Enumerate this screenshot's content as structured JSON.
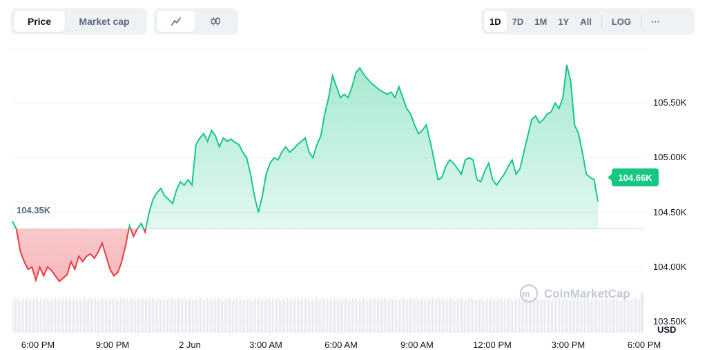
{
  "toolbar": {
    "metric_tabs": [
      {
        "label": "Price",
        "active": true
      },
      {
        "label": "Market cap",
        "active": false
      }
    ],
    "chart_type_icons": [
      "line-chart-icon",
      "candlestick-icon"
    ],
    "ranges": [
      {
        "label": "1D",
        "active": true
      },
      {
        "label": "7D",
        "active": false
      },
      {
        "label": "1M",
        "active": false
      },
      {
        "label": "1Y",
        "active": false
      },
      {
        "label": "All",
        "active": false
      }
    ],
    "log_label": "LOG",
    "more_label": "···"
  },
  "watermark": {
    "text": "CoinMarketCap"
  },
  "open_price_label": "104.35K",
  "current_price_label": "104.66K",
  "currency_label": "USD",
  "colors": {
    "up": "#16c784",
    "down": "#ea3943",
    "current_badge": "#16c784"
  },
  "chart_data": {
    "type": "area",
    "baseline": 104.35,
    "y_unit": "K USD",
    "ylim": [
      103.4,
      106.0
    ],
    "ytick_labels": [
      "105.50K",
      "105.00K",
      "104.50K",
      "104.00K",
      "103.50K"
    ],
    "ytick_values": [
      105.5,
      105.0,
      104.5,
      104.0,
      103.5
    ],
    "xtick_labels": [
      "6:00 PM",
      "9:00 PM",
      "2 Jun",
      "3:00 AM",
      "6:00 AM",
      "9:00 AM",
      "12:00 PM",
      "3:00 PM",
      "6:00 PM"
    ],
    "x_start_label": "6:00 PM",
    "x_end_label": "6:00 PM",
    "hours_span": 24.3,
    "points": [
      [
        0.0,
        104.42
      ],
      [
        0.15,
        104.35
      ],
      [
        0.3,
        104.15
      ],
      [
        0.45,
        104.05
      ],
      [
        0.6,
        103.98
      ],
      [
        0.75,
        104.0
      ],
      [
        0.9,
        103.88
      ],
      [
        1.05,
        104.0
      ],
      [
        1.2,
        103.92
      ],
      [
        1.35,
        104.0
      ],
      [
        1.5,
        103.97
      ],
      [
        1.65,
        103.92
      ],
      [
        1.8,
        103.87
      ],
      [
        1.95,
        103.9
      ],
      [
        2.1,
        103.93
      ],
      [
        2.25,
        104.05
      ],
      [
        2.4,
        103.98
      ],
      [
        2.55,
        104.1
      ],
      [
        2.7,
        104.05
      ],
      [
        2.85,
        104.1
      ],
      [
        3.0,
        104.12
      ],
      [
        3.15,
        104.08
      ],
      [
        3.3,
        104.14
      ],
      [
        3.45,
        104.22
      ],
      [
        3.6,
        104.1
      ],
      [
        3.75,
        103.98
      ],
      [
        3.9,
        103.92
      ],
      [
        4.05,
        103.95
      ],
      [
        4.2,
        104.05
      ],
      [
        4.35,
        104.2
      ],
      [
        4.5,
        104.38
      ],
      [
        4.65,
        104.28
      ],
      [
        4.8,
        104.35
      ],
      [
        4.95,
        104.4
      ],
      [
        5.1,
        104.32
      ],
      [
        5.25,
        104.5
      ],
      [
        5.4,
        104.62
      ],
      [
        5.55,
        104.68
      ],
      [
        5.7,
        104.72
      ],
      [
        5.85,
        104.65
      ],
      [
        6.0,
        104.62
      ],
      [
        6.15,
        104.58
      ],
      [
        6.3,
        104.7
      ],
      [
        6.45,
        104.78
      ],
      [
        6.6,
        104.75
      ],
      [
        6.75,
        104.8
      ],
      [
        6.9,
        104.75
      ],
      [
        7.05,
        105.12
      ],
      [
        7.2,
        105.18
      ],
      [
        7.35,
        105.22
      ],
      [
        7.5,
        105.15
      ],
      [
        7.65,
        105.25
      ],
      [
        7.8,
        105.2
      ],
      [
        7.95,
        105.1
      ],
      [
        8.1,
        105.18
      ],
      [
        8.25,
        105.15
      ],
      [
        8.4,
        105.17
      ],
      [
        8.55,
        105.14
      ],
      [
        8.7,
        105.12
      ],
      [
        8.85,
        105.05
      ],
      [
        9.0,
        105.0
      ],
      [
        9.15,
        104.85
      ],
      [
        9.3,
        104.65
      ],
      [
        9.45,
        104.5
      ],
      [
        9.6,
        104.65
      ],
      [
        9.75,
        104.85
      ],
      [
        9.9,
        104.95
      ],
      [
        10.05,
        105.0
      ],
      [
        10.2,
        104.98
      ],
      [
        10.35,
        105.05
      ],
      [
        10.5,
        105.1
      ],
      [
        10.65,
        105.05
      ],
      [
        10.8,
        105.08
      ],
      [
        10.95,
        105.12
      ],
      [
        11.1,
        105.15
      ],
      [
        11.25,
        105.18
      ],
      [
        11.4,
        105.05
      ],
      [
        11.55,
        105.0
      ],
      [
        11.7,
        105.12
      ],
      [
        11.85,
        105.2
      ],
      [
        12.0,
        105.4
      ],
      [
        12.15,
        105.55
      ],
      [
        12.3,
        105.75
      ],
      [
        12.45,
        105.65
      ],
      [
        12.6,
        105.55
      ],
      [
        12.75,
        105.58
      ],
      [
        12.9,
        105.55
      ],
      [
        13.05,
        105.65
      ],
      [
        13.2,
        105.78
      ],
      [
        13.35,
        105.82
      ],
      [
        13.5,
        105.76
      ],
      [
        13.65,
        105.72
      ],
      [
        13.8,
        105.68
      ],
      [
        13.95,
        105.65
      ],
      [
        14.1,
        105.62
      ],
      [
        14.25,
        105.6
      ],
      [
        14.4,
        105.58
      ],
      [
        14.55,
        105.6
      ],
      [
        14.7,
        105.55
      ],
      [
        14.85,
        105.65
      ],
      [
        15.0,
        105.55
      ],
      [
        15.15,
        105.45
      ],
      [
        15.3,
        105.4
      ],
      [
        15.45,
        105.3
      ],
      [
        15.6,
        105.22
      ],
      [
        15.75,
        105.25
      ],
      [
        15.9,
        105.3
      ],
      [
        16.05,
        105.15
      ],
      [
        16.2,
        104.98
      ],
      [
        16.35,
        104.8
      ],
      [
        16.5,
        104.82
      ],
      [
        16.65,
        104.92
      ],
      [
        16.8,
        104.98
      ],
      [
        16.95,
        104.95
      ],
      [
        17.1,
        104.9
      ],
      [
        17.25,
        104.85
      ],
      [
        17.4,
        104.98
      ],
      [
        17.55,
        105.0
      ],
      [
        17.7,
        104.98
      ],
      [
        17.85,
        104.8
      ],
      [
        18.0,
        104.78
      ],
      [
        18.15,
        104.88
      ],
      [
        18.3,
        104.95
      ],
      [
        18.45,
        104.8
      ],
      [
        18.6,
        104.75
      ],
      [
        18.75,
        104.8
      ],
      [
        18.9,
        104.85
      ],
      [
        19.05,
        104.92
      ],
      [
        19.2,
        104.98
      ],
      [
        19.35,
        104.85
      ],
      [
        19.5,
        104.9
      ],
      [
        19.65,
        105.05
      ],
      [
        19.8,
        105.2
      ],
      [
        19.95,
        105.35
      ],
      [
        20.1,
        105.38
      ],
      [
        20.25,
        105.32
      ],
      [
        20.4,
        105.35
      ],
      [
        20.55,
        105.4
      ],
      [
        20.7,
        105.42
      ],
      [
        20.85,
        105.5
      ],
      [
        21.0,
        105.45
      ],
      [
        21.15,
        105.55
      ],
      [
        21.3,
        105.85
      ],
      [
        21.45,
        105.7
      ],
      [
        21.6,
        105.3
      ],
      [
        21.75,
        105.22
      ],
      [
        21.9,
        105.05
      ],
      [
        22.05,
        104.85
      ],
      [
        22.2,
        104.82
      ],
      [
        22.35,
        104.8
      ],
      [
        22.5,
        104.6
      ]
    ]
  }
}
